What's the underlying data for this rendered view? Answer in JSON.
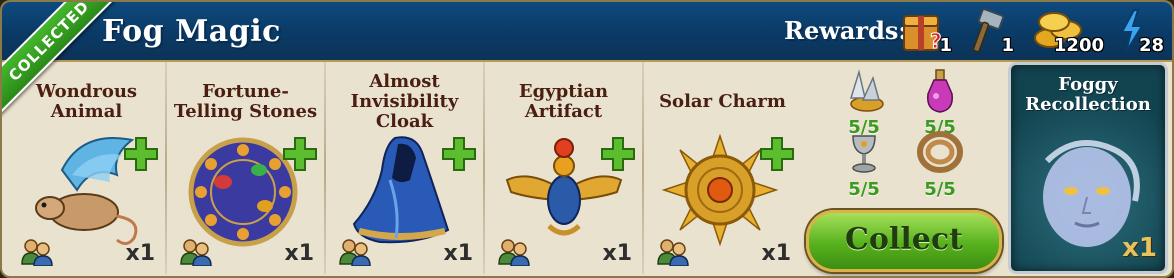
{
  "header": {
    "title": "Fog Magic",
    "collected_ribbon": "COLLECTED",
    "rewards_label": "Rewards:",
    "rewards": [
      {
        "icon": "mystery-chest-icon",
        "value": "1"
      },
      {
        "icon": "hammer-icon",
        "value": "1"
      },
      {
        "icon": "coins-icon",
        "value": "1200"
      },
      {
        "icon": "lightning-energy-icon",
        "value": "28"
      }
    ]
  },
  "items": [
    {
      "name_lines": [
        "Wondrous",
        "Animal"
      ],
      "qty": "x1",
      "icon": "winged-rat-icon"
    },
    {
      "name_lines": [
        "Fortune-",
        "Telling Stones"
      ],
      "qty": "x1",
      "icon": "fortune-stones-disc-icon"
    },
    {
      "name_lines": [
        "Almost",
        "Invisibility",
        "Cloak"
      ],
      "qty": "x1",
      "icon": "blue-cloak-icon"
    },
    {
      "name_lines": [
        "Egyptian",
        "Artifact"
      ],
      "qty": "x1",
      "icon": "scarab-artifact-icon"
    },
    {
      "name_lines": [
        "Solar Charm"
      ],
      "qty": "x1",
      "icon": "sun-amulet-icon"
    }
  ],
  "materials": [
    {
      "icon": "crystal-gold-icon",
      "count": "5/5"
    },
    {
      "icon": "potion-bottle-icon",
      "count": "5/5"
    },
    {
      "icon": "goblet-icon",
      "count": "5/5"
    },
    {
      "icon": "rope-coil-icon",
      "count": "5/5"
    }
  ],
  "collect_label": "Collect",
  "result": {
    "name_lines": [
      "Foggy",
      "Recollection"
    ],
    "qty": "x1",
    "icon": "fog-face-icon"
  },
  "colors": {
    "header_blue": "#0a3a66",
    "panel_bg": "#e9e2cf",
    "item_name": "#4a1e10",
    "count_green": "#3d9a20",
    "button_green": "#58b21e",
    "ribbon_green": "#2a8a18"
  }
}
